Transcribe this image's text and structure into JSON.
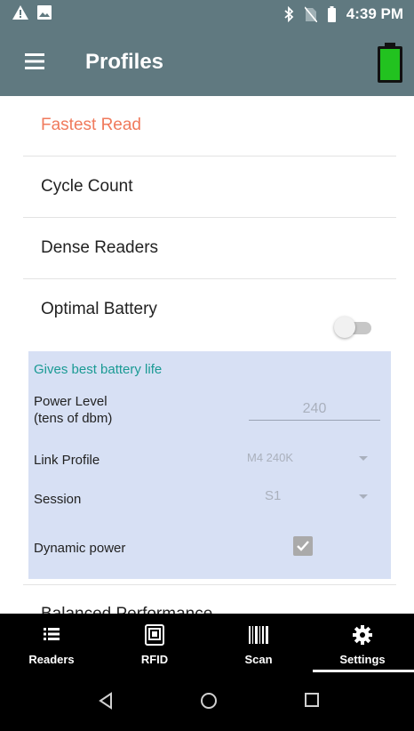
{
  "status_bar": {
    "time": "4:39 PM",
    "icons": [
      "warning-icon",
      "image-icon",
      "bluetooth-icon",
      "no-sim-icon",
      "battery-status-icon"
    ]
  },
  "app_bar": {
    "title": "Profiles",
    "battery_color": "#22c21f"
  },
  "profiles": [
    {
      "label": "Fastest Read"
    },
    {
      "label": "Cycle Count"
    },
    {
      "label": "Dense Readers"
    },
    {
      "label": "Optimal Battery"
    },
    {
      "label": "Balanced Performance"
    }
  ],
  "optimal_battery": {
    "toggle_on": false,
    "description": "Gives best battery life",
    "power_level_label": "Power Level\n(tens of dbm)",
    "power_level_value": "240",
    "link_profile_label": "Link Profile",
    "link_profile_value": "M4 240K",
    "session_label": "Session",
    "session_value": "S1",
    "dynamic_power_label": "Dynamic power",
    "dynamic_power_checked": true
  },
  "bottom_nav": {
    "items": [
      {
        "label": "Readers",
        "icon": "list-icon"
      },
      {
        "label": "RFID",
        "icon": "rfid-icon"
      },
      {
        "label": "Scan",
        "icon": "barcode-icon"
      },
      {
        "label": "Settings",
        "icon": "gear-icon"
      }
    ],
    "active": "Settings"
  },
  "colors": {
    "header": "#607980",
    "active_profile": "#f07a5c",
    "panel": "#d7e0f4",
    "panel_heading": "#1a9a94"
  }
}
